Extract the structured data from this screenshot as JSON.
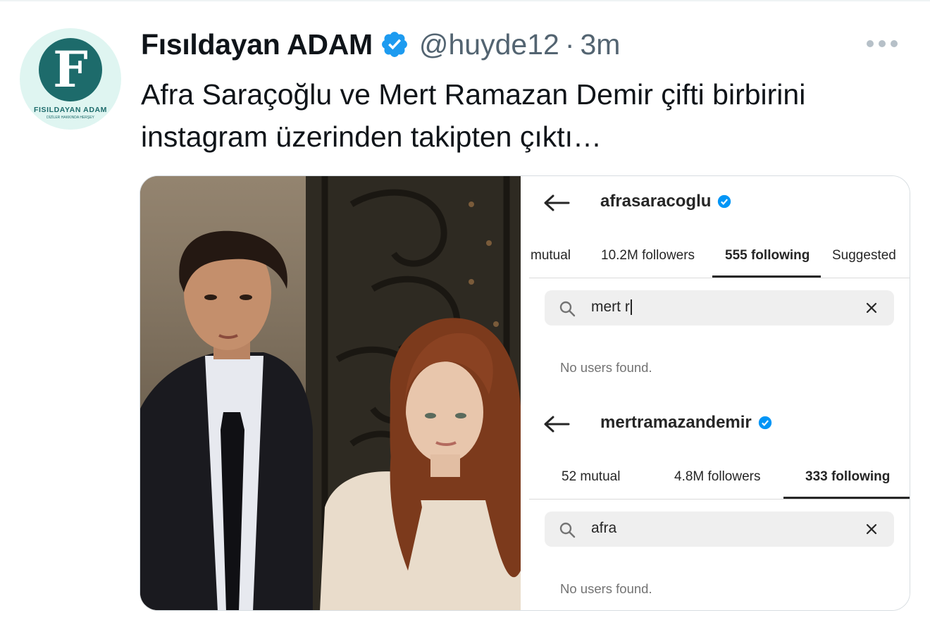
{
  "tweet": {
    "display_name": "Fısıldayan ADAM",
    "handle": "@huyde12",
    "separator": "·",
    "time": "3m",
    "text": "Afra Saraçoğlu ve Mert Ramazan Demir çifti birbirini instagram üzerinden takipten çıktı…",
    "avatar": {
      "letter": "F",
      "brand": "FISILDAYAN ADAM",
      "tagline": "DİZİLER HAKKINDA HERŞEY"
    },
    "icons": {
      "verified": "verified-badge-icon",
      "more": "more-options-icon"
    },
    "colors": {
      "verified": "#1d9bf0",
      "secondary_text": "#536471",
      "avatar_bg": "#dff5f1",
      "avatar_brand": "#1d6b6b"
    }
  },
  "screenshots": [
    {
      "username": "afrasaracoglu",
      "tabs": [
        {
          "label": "mutual"
        },
        {
          "label": "10.2M followers"
        },
        {
          "label": "555 following",
          "active": true
        },
        {
          "label": "Suggested"
        }
      ],
      "search": {
        "value": "mert r"
      },
      "result": "No users found."
    },
    {
      "username": "mertramazandemir",
      "tabs": [
        {
          "label": "52 mutual"
        },
        {
          "label": "4.8M followers"
        },
        {
          "label": "333 following",
          "active": true
        }
      ],
      "search": {
        "value": "afra"
      },
      "result": "No users found."
    }
  ]
}
